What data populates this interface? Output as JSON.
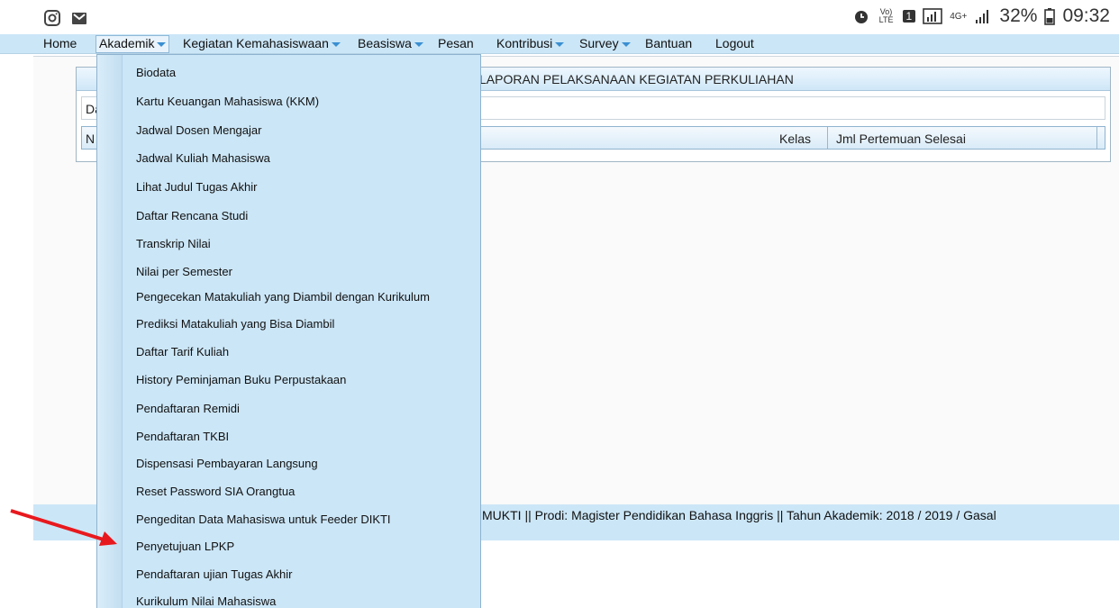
{
  "status": {
    "battery_percent": "32%",
    "time": "09:32",
    "network": "4G+",
    "volte": "Vo) LTE",
    "sim": "1"
  },
  "menubar": {
    "items": [
      {
        "label": "Home",
        "dropdown": false
      },
      {
        "label": "Akademik",
        "dropdown": true
      },
      {
        "label": "Kegiatan Kemahasiswaan",
        "dropdown": true
      },
      {
        "label": "Beasiswa",
        "dropdown": true
      },
      {
        "label": "Pesan",
        "dropdown": false
      },
      {
        "label": "Kontribusi",
        "dropdown": true
      },
      {
        "label": "Survey",
        "dropdown": true
      },
      {
        "label": "Bantuan",
        "dropdown": false
      },
      {
        "label": "Logout",
        "dropdown": false
      }
    ]
  },
  "panel": {
    "title": "LAPORAN PELAKSANAAN KEGIATAN PERKULIAHAN",
    "row_label": "Da",
    "columns": [
      "N",
      "Kelas",
      "Jml Pertemuan Selesai"
    ]
  },
  "footer": {
    "text": "MUKTI || Prodi: Magister Pendidikan Bahasa Inggris || Tahun Akademik: 2018 / 2019 / Gasal"
  },
  "dropdown": {
    "items": [
      "Biodata",
      "Kartu Keuangan Mahasiswa (KKM)",
      "Jadwal Dosen Mengajar",
      "Jadwal Kuliah Mahasiswa",
      "Lihat Judul Tugas Akhir",
      "Daftar Rencana Studi",
      "Transkrip Nilai",
      "Nilai per Semester",
      "Pengecekan Matakuliah yang Diambil dengan Kurikulum",
      "Prediksi Matakuliah yang Bisa Diambil",
      "Daftar Tarif Kuliah",
      "History Peminjaman Buku Perpustakaan",
      "Pendaftaran Remidi",
      "Pendaftaran TKBI",
      "Dispensasi Pembayaran Langsung",
      "Reset Password SIA Orangtua",
      "Pengeditan Data Mahasiswa untuk Feeder DIKTI",
      "Penyetujuan LPKP",
      "Pendaftaran ujian Tugas Akhir",
      "Kurikulum Nilai Mahasiswa"
    ]
  },
  "colors": {
    "menubar": "#cbe6f7",
    "arrow": "#e8191e"
  }
}
